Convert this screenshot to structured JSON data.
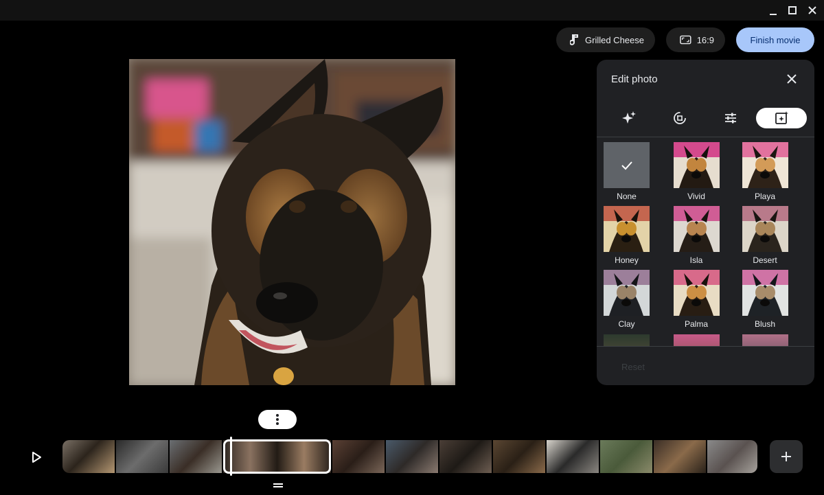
{
  "window": {
    "controls": [
      "minimize",
      "maximize",
      "close"
    ]
  },
  "toolbar": {
    "music_label": "Grilled Cheese",
    "aspect_label": "16:9",
    "finish_label": "Finish movie"
  },
  "panel": {
    "title": "Edit photo",
    "tabs": [
      {
        "icon": "sparkle-icon",
        "active": false
      },
      {
        "icon": "crop-rotate-icon",
        "active": false
      },
      {
        "icon": "sliders-icon",
        "active": false
      },
      {
        "icon": "filter-icon",
        "active": true
      }
    ],
    "filters": [
      {
        "label": "None",
        "selected": true
      },
      {
        "label": "Vivid"
      },
      {
        "label": "Playa"
      },
      {
        "label": "Honey"
      },
      {
        "label": "Isla"
      },
      {
        "label": "Desert"
      },
      {
        "label": "Clay"
      },
      {
        "label": "Palma"
      },
      {
        "label": "Blush"
      }
    ],
    "reset_label": "Reset"
  },
  "colors": {
    "accent": "#a8c7fa",
    "panel_bg": "#202124",
    "background": "#000000"
  }
}
